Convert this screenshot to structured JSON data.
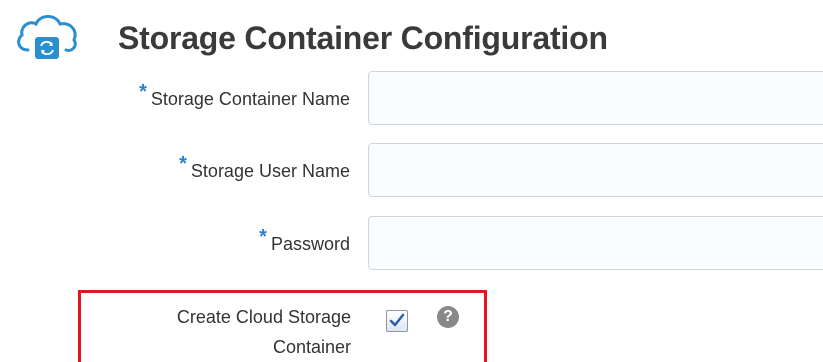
{
  "header": {
    "title": "Storage Container Configuration",
    "icon": "cloud-sync-icon"
  },
  "colors": {
    "required_marker": "#2a7fd4",
    "highlight_border": "#e2161c",
    "icon_blue": "#2a8fd1"
  },
  "form": {
    "required_marker": "*",
    "fields": [
      {
        "label": "Storage Container Name",
        "required": true,
        "value": ""
      },
      {
        "label": "Storage User Name",
        "required": true,
        "value": ""
      },
      {
        "label": "Password",
        "required": true,
        "value": ""
      }
    ],
    "create_container": {
      "label_line1": "Create Cloud Storage",
      "label_line2": "Container",
      "checked": true,
      "help_icon": "question-circle-icon",
      "help_glyph": "?"
    }
  }
}
